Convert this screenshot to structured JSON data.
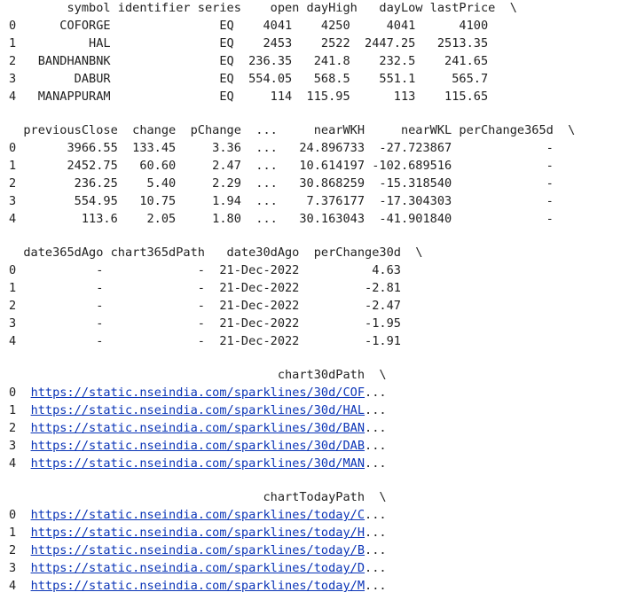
{
  "block1": {
    "header": "        symbol identifier series    open dayHigh   dayLow lastPrice  \\",
    "rows": [
      "0      COFORGE               EQ    4041    4250     4041      4100",
      "1          HAL               EQ    2453    2522  2447.25   2513.35",
      "2   BANDHANBNK               EQ  236.35   241.8    232.5    241.65",
      "3        DABUR               EQ  554.05   568.5    551.1     565.7",
      "4   MANAPPURAM               EQ     114  115.95      113    115.65"
    ]
  },
  "block2": {
    "header": "  previousClose  change  pChange  ...     nearWKH     nearWKL perChange365d  \\",
    "rows": [
      "0       3966.55  133.45     3.36  ...   24.896733  -27.723867             -",
      "1       2452.75   60.60     2.47  ...   10.614197 -102.689516             -",
      "2        236.25    5.40     2.29  ...   30.868259  -15.318540             -",
      "3        554.95   10.75     1.94  ...    7.376177  -17.304303             -",
      "4         113.6    2.05     1.80  ...   30.163043  -41.901840             -"
    ]
  },
  "block3": {
    "header": "  date365dAgo chart365dPath   date30dAgo  perChange30d  \\",
    "rows": [
      "0           -             -  21-Dec-2022          4.63",
      "1           -             -  21-Dec-2022         -2.81",
      "2           -             -  21-Dec-2022         -2.47",
      "3           -             -  21-Dec-2022         -1.95",
      "4           -             -  21-Dec-2022         -1.91"
    ]
  },
  "block4": {
    "header": "                                     chart30dPath  \\",
    "rows": [
      {
        "idx": "0  ",
        "link": "https://static.nseindia.com/sparklines/30d/COF",
        "tail": "..."
      },
      {
        "idx": "1  ",
        "link": "https://static.nseindia.com/sparklines/30d/HAL",
        "tail": "..."
      },
      {
        "idx": "2  ",
        "link": "https://static.nseindia.com/sparklines/30d/BAN",
        "tail": "..."
      },
      {
        "idx": "3  ",
        "link": "https://static.nseindia.com/sparklines/30d/DAB",
        "tail": "..."
      },
      {
        "idx": "4  ",
        "link": "https://static.nseindia.com/sparklines/30d/MAN",
        "tail": "..."
      }
    ]
  },
  "block5": {
    "header": "                                   chartTodayPath  \\",
    "rows": [
      {
        "idx": "0  ",
        "link": "https://static.nseindia.com/sparklines/today/C",
        "tail": "..."
      },
      {
        "idx": "1  ",
        "link": "https://static.nseindia.com/sparklines/today/H",
        "tail": "..."
      },
      {
        "idx": "2  ",
        "link": "https://static.nseindia.com/sparklines/today/B",
        "tail": "..."
      },
      {
        "idx": "3  ",
        "link": "https://static.nseindia.com/sparklines/today/D",
        "tail": "..."
      },
      {
        "idx": "4  ",
        "link": "https://static.nseindia.com/sparklines/today/M",
        "tail": "..."
      }
    ]
  }
}
